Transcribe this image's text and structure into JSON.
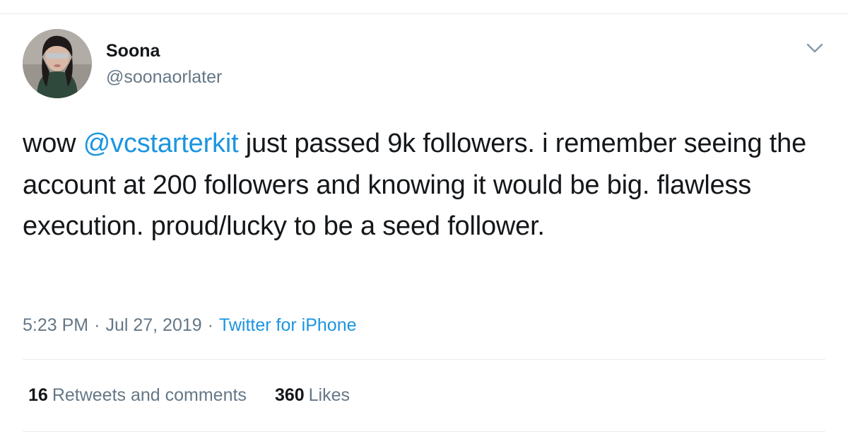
{
  "author": {
    "display_name": "Soona",
    "handle": "@soonaorlater",
    "avatar_icon": "user-avatar"
  },
  "tweet": {
    "text_before": "wow ",
    "mention": "@vcstarterkit",
    "text_after": " just passed 9k followers. i remember seeing the account at 200 followers and knowing it would be big. flawless execution. proud/lucky to be a seed follower."
  },
  "meta": {
    "time": "5:23 PM",
    "separator": "·",
    "date": "Jul 27, 2019",
    "source": "Twitter for iPhone"
  },
  "stats": {
    "retweets_count": "16",
    "retweets_label": "Retweets and comments",
    "likes_count": "360",
    "likes_label": "Likes"
  },
  "colors": {
    "link": "#1b95e0",
    "secondary_text": "#657786",
    "primary_text": "#14171a",
    "divider": "#e6ecf0"
  },
  "icons": {
    "menu": "chevron-down-icon"
  }
}
